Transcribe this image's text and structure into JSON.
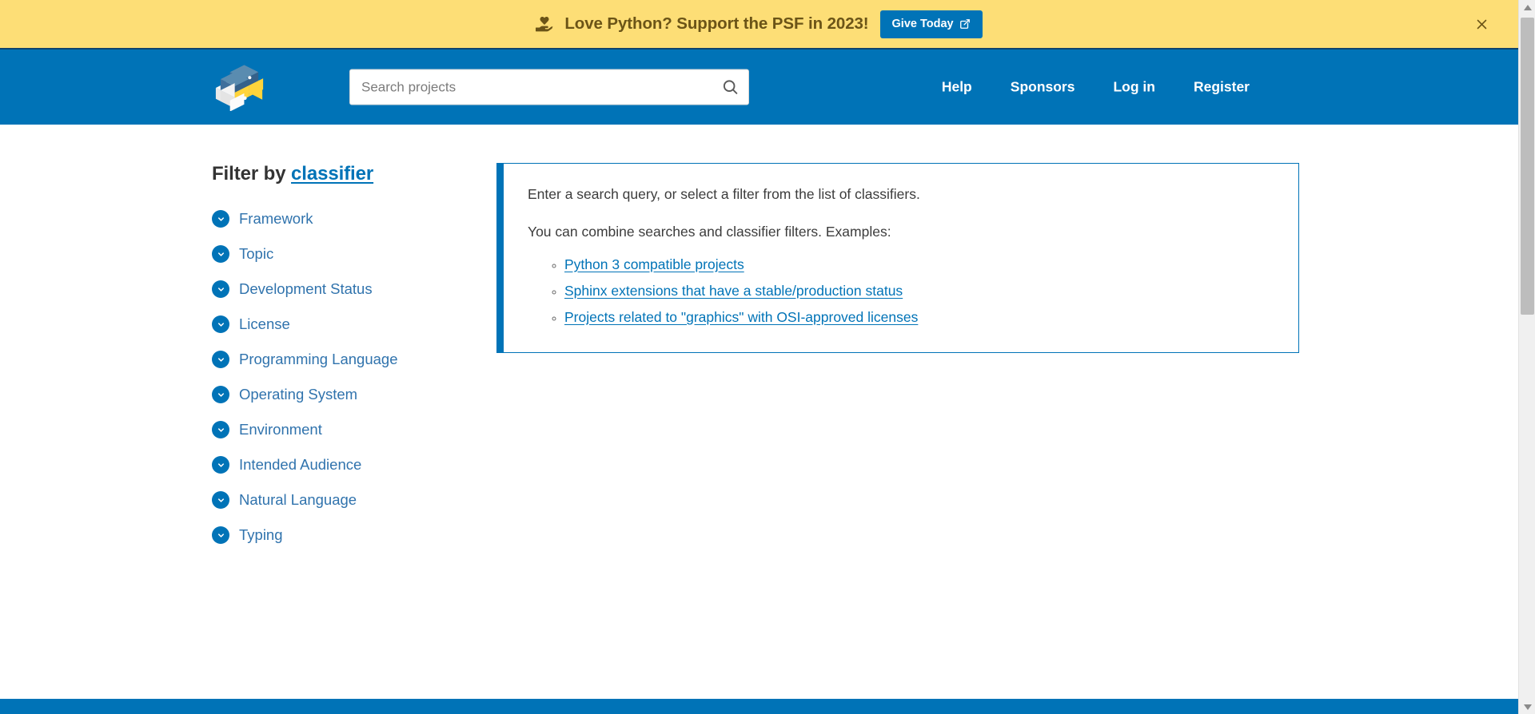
{
  "banner": {
    "icon": "hand-holding-heart-icon",
    "text": "Love Python? Support the PSF in 2023!",
    "button_label": "Give Today",
    "button_icon": "external-link-icon",
    "close_icon": "close-icon",
    "background": "#fdde76",
    "text_color": "#6b5417",
    "button_color": "#0073b7"
  },
  "header": {
    "logo_name": "pypi-logo",
    "search": {
      "placeholder": "Search projects",
      "value": "",
      "icon": "search-icon"
    },
    "nav": [
      {
        "label": "Help"
      },
      {
        "label": "Sponsors"
      },
      {
        "label": "Log in"
      },
      {
        "label": "Register"
      }
    ],
    "background": "#0073b7"
  },
  "sidebar": {
    "heading_prefix": "Filter by ",
    "heading_link": "classifier",
    "items": [
      {
        "label": "Framework",
        "icon": "chevron-down-icon"
      },
      {
        "label": "Topic",
        "icon": "chevron-down-icon"
      },
      {
        "label": "Development Status",
        "icon": "chevron-down-icon"
      },
      {
        "label": "License",
        "icon": "chevron-down-icon"
      },
      {
        "label": "Programming Language",
        "icon": "chevron-down-icon"
      },
      {
        "label": "Operating System",
        "icon": "chevron-down-icon"
      },
      {
        "label": "Environment",
        "icon": "chevron-down-icon"
      },
      {
        "label": "Intended Audience",
        "icon": "chevron-down-icon"
      },
      {
        "label": "Natural Language",
        "icon": "chevron-down-icon"
      },
      {
        "label": "Typing",
        "icon": "chevron-down-icon"
      }
    ]
  },
  "callout": {
    "paragraph_1": "Enter a search query, or select a filter from the list of classifiers.",
    "paragraph_2": "You can combine searches and classifier filters. Examples:",
    "examples": [
      {
        "label": "Python 3 compatible projects"
      },
      {
        "label": "Sphinx extensions that have a stable/production status"
      },
      {
        "label": "Projects related to \"graphics\" with OSI-approved licenses"
      }
    ],
    "accent_color": "#0073b7"
  },
  "scrollbar": {
    "up_icon": "scroll-up-arrow-icon",
    "down_icon": "scroll-down-arrow-icon",
    "thumb": "scrollbar-thumb"
  }
}
